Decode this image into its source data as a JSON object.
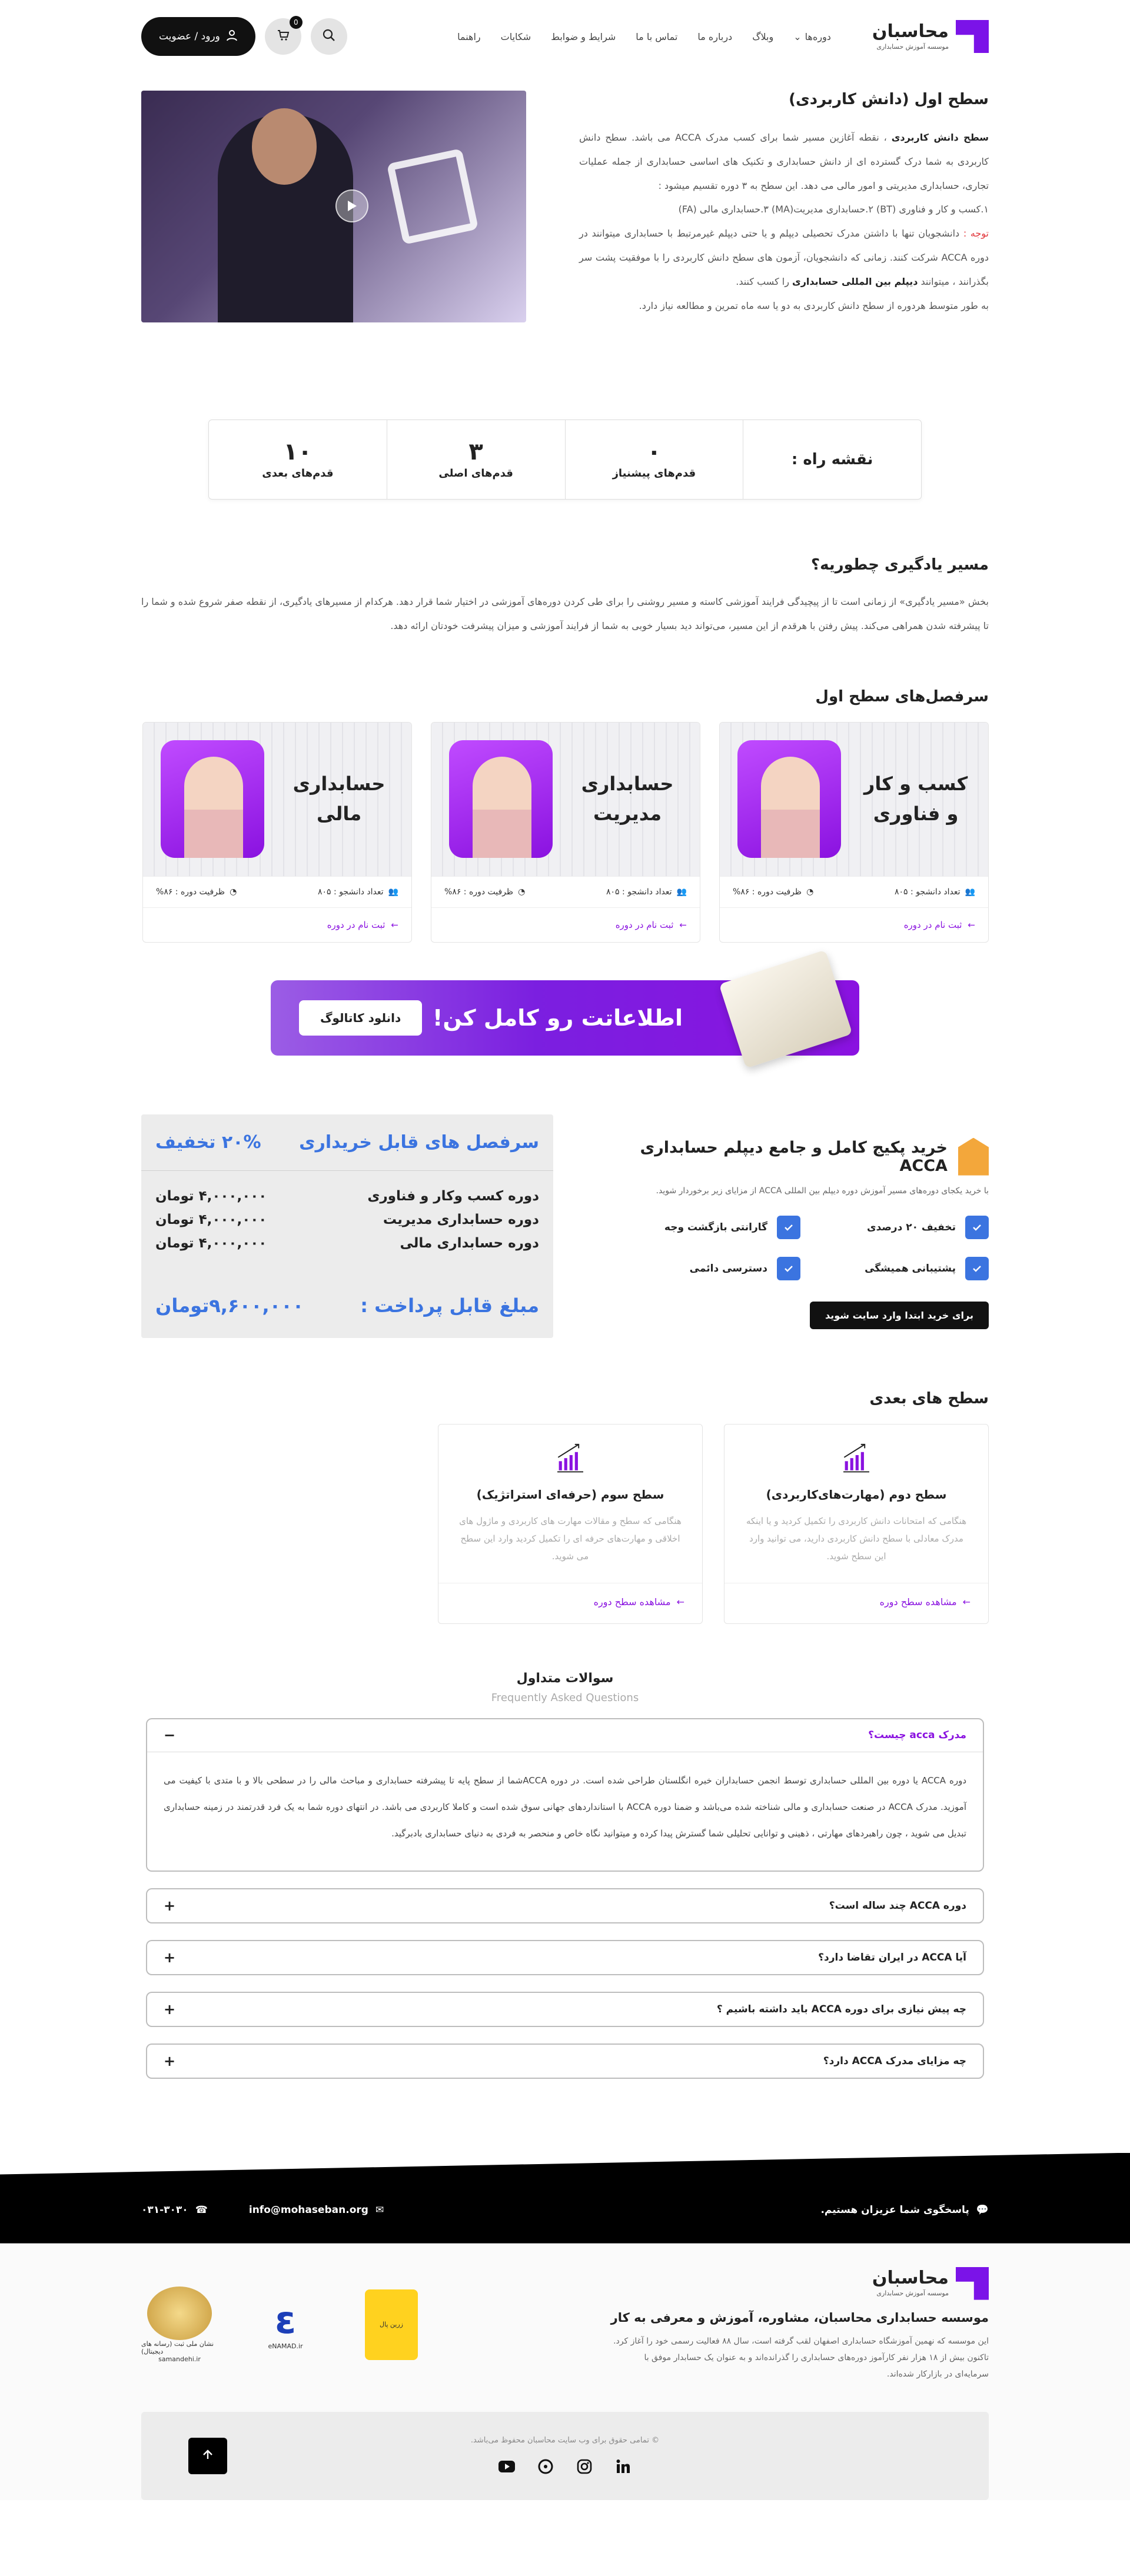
{
  "header": {
    "logo_title": "محاسبان",
    "logo_sub": "موسسه آموزش حسابداری",
    "nav": [
      "دوره‌ها",
      "وبلاگ",
      "درباره ما",
      "تماس با ما",
      "شرایط و ضوابط",
      "شکایات",
      "راهنما"
    ],
    "login_label": "ورود / عضویت",
    "cart_count": "0"
  },
  "intro": {
    "title": "سطح اول (دانش کاربردی)",
    "p1_bold": "سطح دانش کاربردی",
    "p1": "، نقطه آغازین مسیر شما برای کسب مدرک ACCA می باشد. سطح دانش کاربردی به شما درک گسترده ای از دانش حسابداری و تکنیک های اساسی حسابداری از جمله عملیات تجاری، حسابداری مدیریتی و امور مالی می دهد. این سطح به ۳ دوره تقسیم میشود :",
    "p2": "۱.کسب و کار و فناوری (BT) ۲.حسابداری مدیریت(MA) ۳.حسابداری مالی (FA)",
    "note_label": "توجه :",
    "p3": "دانشجویان تنها با داشتن مدرک تحصیلی دیپلم و یا حتی دیپلم غیرمرتبط با حسابداری میتوانند در دوره ACCA شرکت کنند. زمانی که دانشجویان، آزمون های سطح دانش کاربردی را با موفقیت پشت سر بگذرانند ، میتوانند",
    "p3_bold": "دیپلم بین المللی حسابداری",
    "p3_end": "را کسب کنند.",
    "p4": "به طور متوسط هردوره از سطح دانش کاربردی به دو یا سه ماه تمرین و مطالعه نیاز دارد."
  },
  "roadmap": {
    "title": "نقشه راه :",
    "cells": [
      {
        "num": "۰",
        "label": "قدم‌های پیشنیاز"
      },
      {
        "num": "۳",
        "label": "قدم‌های اصلی"
      },
      {
        "num": "۱۰",
        "label": "قدم‌های بعدی"
      }
    ]
  },
  "path": {
    "title": "مسیر یادگیری چطوریه؟",
    "text": "بخش «مسیر یادگیری» از زمانی است تا از پیچیدگی فرایند آموزشی کاسته و مسیر روشنی را برای طی کردن دوره‌های آموزشی در اختیار شما قرار دهد. هرکدام از مسیرهای یادگیری، از نقطه صفر شروع شده و شما را تا پیشرفته شدن همراهی می‌کند. پیش رفتن با هرقدم از این مسیر، می‌تواند دید بسیار خوبی به شما از فرایند آموزشی و میزان پیشرفت خودتان ارائه دهد."
  },
  "courses": {
    "title": "سرفصل‌های سطح اول",
    "items": [
      {
        "name": "کسب و کار و فناوری",
        "students": "تعداد دانشجو : ۸۰۵",
        "capacity": "ظرفیت دوره : ۸۶%",
        "link": "ثبت نام در دوره"
      },
      {
        "name": "حسابداری مدیریت",
        "students": "تعداد دانشجو : ۸۰۵",
        "capacity": "ظرفیت دوره : ۸۶%",
        "link": "ثبت نام در دوره"
      },
      {
        "name": "حسابداری مالی",
        "students": "تعداد دانشجو : ۸۰۵",
        "capacity": "ظرفیت دوره : ۸۶%",
        "link": "ثبت نام در دوره"
      }
    ]
  },
  "banner": {
    "text": "اطلاعاتت رو کامل کن!",
    "button": "دانلود کاتالوگ"
  },
  "package": {
    "title": "خرید پکیج کامل و جامع دیپلم حسابداری ACCA",
    "sub": "با خرید یکجای دوره‌های مسیر آموزش دوره دیپلم بین المللی ACCA از مزایای زیر برخوردار شوید.",
    "features": [
      "تخفیف ۲۰ درصدی",
      "گارانتی بازگشت وجه",
      "پشتیبانی همیشگی",
      "دسترسی دائمی"
    ],
    "buy_button": "برای خرید ابتدا وارد سایت شوید"
  },
  "price": {
    "head": "سرفصل های قابل خریداری",
    "discount": "۲۰% تخفیف",
    "rows": [
      {
        "name": "دوره کسب وکار و فناوری",
        "price": "۴,۰۰۰,۰۰۰ تومان"
      },
      {
        "name": "دوره حسابداری مدیریت",
        "price": "۴,۰۰۰,۰۰۰ تومان"
      },
      {
        "name": "دوره حسابداری مالی",
        "price": "۴,۰۰۰,۰۰۰ تومان"
      }
    ],
    "total_label": "مبلغ قابل پرداخت :",
    "total": "۹,۶۰۰,۰۰۰تومان"
  },
  "next": {
    "title": "سطح های بعدی",
    "items": [
      {
        "title": "سطح دوم (مهارت‌های‌کاربردی)",
        "desc": "هنگامی که امتحانات دانش کاربردی را تکمیل کردید و یا اینکه مدرک معادلی با سطح دانش کاربردی دارید، می توانید وارد این سطح شوید.",
        "link": "مشاهده سطح دوره"
      },
      {
        "title": "سطح سوم (حرفه‌ای استراتژیک)",
        "desc": "هنگامی که سطح و مقالات مهارت های کاربردی و ماژول های اخلاقی و مهارت‌های حرفه ای را تکمیل کردید وارد این سطح می شوید.",
        "link": "مشاهده سطح دوره"
      }
    ]
  },
  "faq": {
    "title": "سوالات متداول",
    "sub": "Frequently Asked Questions",
    "items": [
      {
        "q": "مدرک acca چیست؟",
        "a": "دوره ACCA یا دوره بین المللی حسابداری توسط انجمن حسابداران خبره انگلستان طراحی شده است. در دوره ACCAشما از سطح پایه تا پیشرفته حسابداری و مباحث مالی را در سطحی بالا و با متدی با کیفیت می آموزید. مدرک ACCA در صنعت حسابداری و مالی شناخته شده می‌باشد و ضمنا دوره ACCA با استانداردهای جهانی سوق شده است و کاملا کاربردی می باشد. در انتهای دوره شما به یک فرد قدرتمند در زمینه حسابداری تبدیل می شوید ، چون راهبردهای مهارتی ، ذهینی و توانایی تحلیلی شما گسترش پیدا کرده و میتوانید نگاه خاص و منحصر به فردی به دنیای حسابداری بادبرگید.",
        "open": true
      },
      {
        "q": "دوره ACCA چند ساله است؟"
      },
      {
        "q": "آیا ACCA در ایران تقاضا دارد؟"
      },
      {
        "q": "چه پیش نیازی برای دوره ACCA باید داشته باشیم ؟"
      },
      {
        "q": "چه مزایای مدرک ACCA دارد؟"
      }
    ]
  },
  "band": {
    "text": "پاسخگوی شما عزیزان هستیم.",
    "email": "info@mohaseban.org",
    "phone": "۰۳۱-۳۰۳۰"
  },
  "footer": {
    "logo_title": "محاسبان",
    "logo_sub": "موسسه آموزش حسابداری",
    "heading": "موسسه حسابداری محاسبان، مشاوره، آموزش و معرفی به کار",
    "about": "این موسسه که نهمین آموزشگاه حسابداری اصفهان لقب گرفته است، سال ۸۸ فعالیت رسمی خود را آغاز کرد. تاکنون بیش از ۱۸ هزار نفر کارآموز دوره‌های حسابداری را گذرانده‌اند و به عنوان یک حسابدار موفق با سرمایه‌ای در بازارکار شده‌اند.",
    "badges": {
      "samandehi": "نشان ملی ثبت (رسانه های دیجیتال)",
      "samandehi_url": "samandehi.ir",
      "enamad": "eNAMAD.ir",
      "zarin": "زرین پال"
    },
    "copyright": "© تمامی حقوق برای وب سایت محاسبان محفوظ می‌باشد."
  }
}
